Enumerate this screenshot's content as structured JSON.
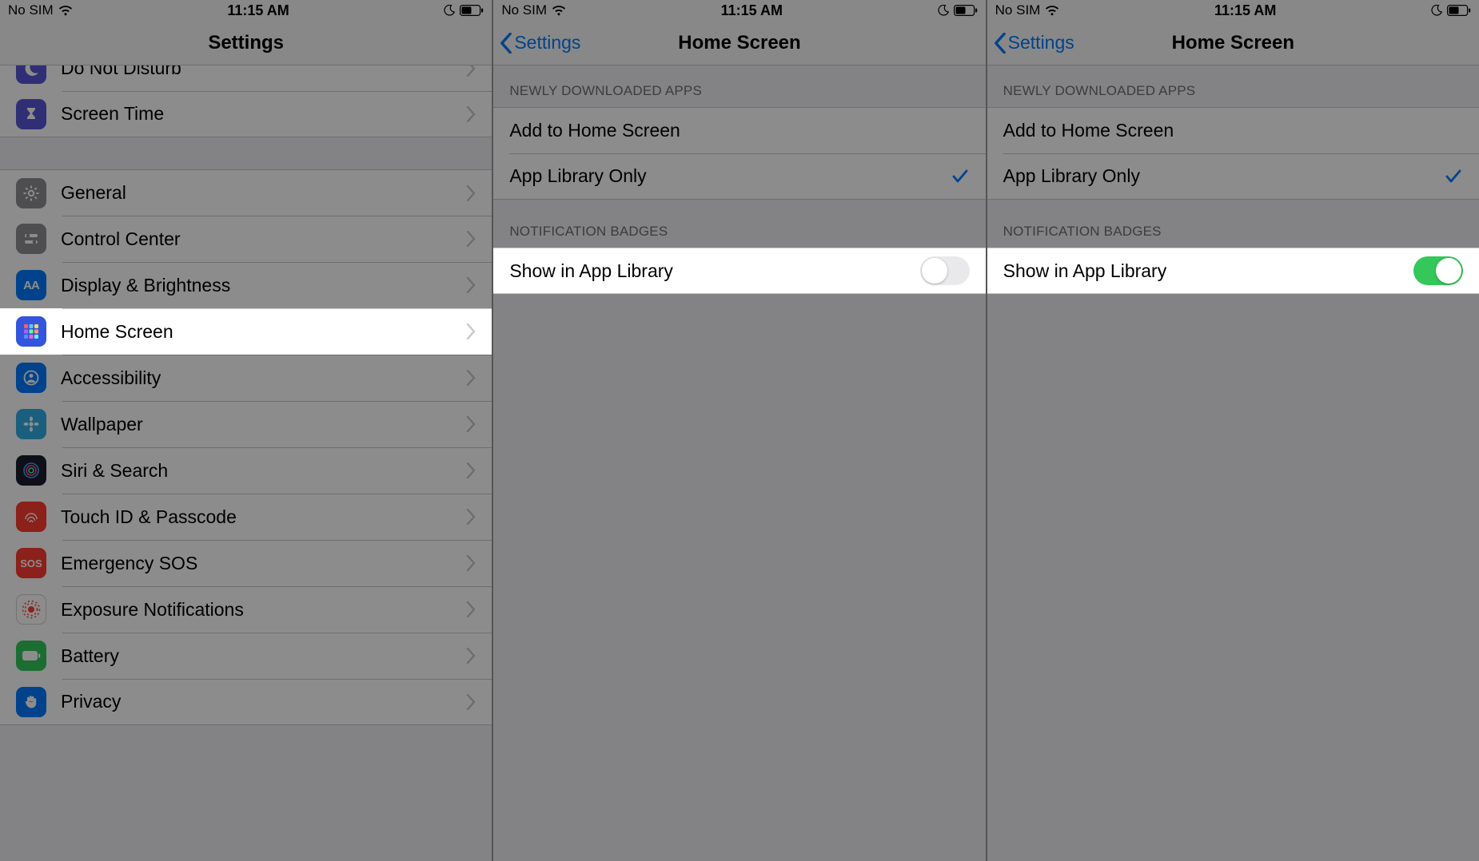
{
  "status": {
    "carrier": "No SIM",
    "time": "11:15 AM"
  },
  "settings": {
    "title": "Settings",
    "groupA": [
      {
        "label": "Do Not Disturb",
        "iconColor": "#5856d6",
        "glyph": "moon"
      },
      {
        "label": "Screen Time",
        "iconColor": "#5856d6",
        "glyph": "hourglass"
      }
    ],
    "groupB": [
      {
        "label": "General",
        "iconColor": "#8e8e93",
        "glyph": "gear"
      },
      {
        "label": "Control Center",
        "iconColor": "#8e8e93",
        "glyph": "switches"
      },
      {
        "label": "Display & Brightness",
        "iconColor": "#007aff",
        "glyph": "AA"
      },
      {
        "label": "Home Screen",
        "iconColor": "#3355dd",
        "glyph": "grid",
        "highlight": true
      },
      {
        "label": "Accessibility",
        "iconColor": "#007aff",
        "glyph": "person"
      },
      {
        "label": "Wallpaper",
        "iconColor": "#32ade6",
        "glyph": "flower"
      },
      {
        "label": "Siri & Search",
        "iconColor": "#1c1c2e",
        "glyph": "siri"
      },
      {
        "label": "Touch ID & Passcode",
        "iconColor": "#ff3b30",
        "glyph": "finger"
      },
      {
        "label": "Emergency SOS",
        "iconColor": "#ff3b30",
        "glyph": "SOS"
      },
      {
        "label": "Exposure Notifications",
        "iconColor": "#ffffff",
        "glyph": "expo"
      },
      {
        "label": "Battery",
        "iconColor": "#34c759",
        "glyph": "battery"
      },
      {
        "label": "Privacy",
        "iconColor": "#007aff",
        "glyph": "hand"
      }
    ]
  },
  "homeScreen": {
    "title": "Home Screen",
    "backLabel": "Settings",
    "section1Header": "NEWLY DOWNLOADED APPS",
    "option1": "Add to Home Screen",
    "option2": "App Library Only",
    "section2Header": "NOTIFICATION BADGES",
    "toggleLabel": "Show in App Library"
  },
  "panes": [
    {
      "kind": "settings",
      "dimmed": true
    },
    {
      "kind": "homescreen",
      "dimmed": true,
      "toggleOn": false,
      "highlightToggleRow": true
    },
    {
      "kind": "homescreen",
      "dimmed": true,
      "toggleOn": true,
      "highlightToggleRow": true
    }
  ]
}
